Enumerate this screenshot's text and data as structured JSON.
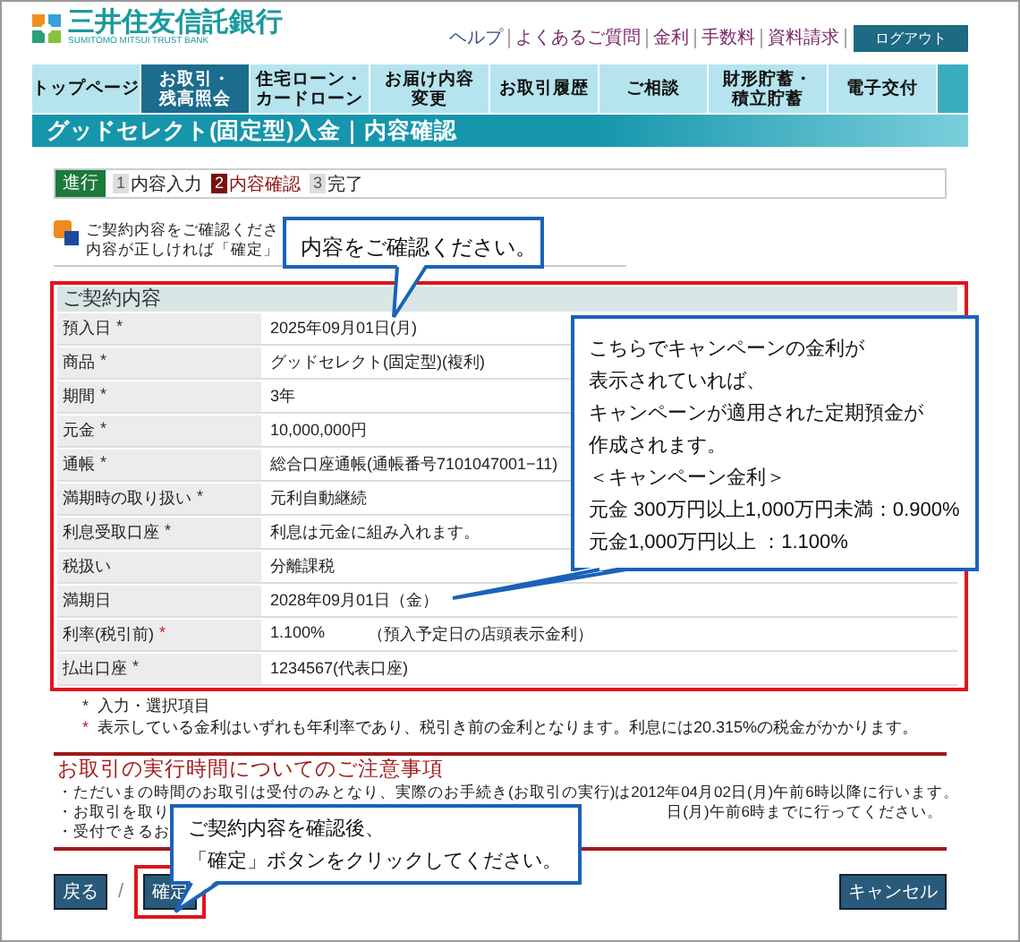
{
  "header": {
    "bank_name": "三井住友信託銀行",
    "bank_name_en": "SUMITOMO MITSUI TRUST BANK",
    "links": [
      "ヘルプ",
      "よくあるご質問",
      "金利",
      "手数料",
      "資料請求"
    ],
    "logout": "ログアウト"
  },
  "nav_tabs": [
    {
      "lines": [
        "トップページ"
      ],
      "selected": false
    },
    {
      "lines": [
        "お取引・",
        "残高照会"
      ],
      "selected": true
    },
    {
      "lines": [
        "住宅ローン・",
        "カードローン"
      ],
      "selected": false
    },
    {
      "lines": [
        "お届け内容",
        "変更"
      ],
      "selected": false
    },
    {
      "lines": [
        "お取引履歴"
      ],
      "selected": false
    },
    {
      "lines": [
        "ご相談"
      ],
      "selected": false
    },
    {
      "lines": [
        "財形貯蓄・",
        "積立貯蓄"
      ],
      "selected": false
    },
    {
      "lines": [
        "電子交付"
      ],
      "selected": false
    }
  ],
  "page_title": "グッドセレクト(固定型)入金｜内容確認",
  "progress": {
    "label": "進行",
    "steps": [
      {
        "number": "1",
        "label": "内容入力",
        "selected": false
      },
      {
        "number": "2",
        "label": "内容確認",
        "selected": true
      },
      {
        "number": "3",
        "label": "完了",
        "selected": false
      }
    ]
  },
  "instructions": [
    "ご契約内容をご確認くださ",
    "内容が正しければ「確定」"
  ],
  "contract": {
    "heading": "ご契約内容",
    "rows": [
      {
        "label": "預入日",
        "mark": {
          "text": "*",
          "color": "#333333"
        },
        "value": "2025年09月01日(月)"
      },
      {
        "label": "商品",
        "mark": {
          "text": "*",
          "color": "#333333"
        },
        "value": "グッドセレクト(固定型)(複利)"
      },
      {
        "label": "期間",
        "mark": {
          "text": "*",
          "color": "#333333"
        },
        "value": "3年"
      },
      {
        "label": "元金",
        "mark": {
          "text": "*",
          "color": "#333333"
        },
        "value": "10,000,000円"
      },
      {
        "label": "通帳",
        "mark": {
          "text": "*",
          "color": "#333333"
        },
        "value": "総合口座通帳(通帳番号7101047001−11)"
      },
      {
        "label": "満期時の取り扱い",
        "mark": {
          "text": "*",
          "color": "#333333"
        },
        "value": "元利自動継続"
      },
      {
        "label": "利息受取口座",
        "mark": {
          "text": "*",
          "color": "#333333"
        },
        "value": "利息は元金に組み入れます。"
      },
      {
        "label": "税扱い",
        "value": "分離課税"
      },
      {
        "label": "満期日",
        "value": "2028年09月01日（金）"
      },
      {
        "label": "利率(税引前)",
        "mark": {
          "text": "*",
          "color": "#c0202a"
        },
        "value": "1.100%",
        "note": "（預入予定日の店頭表示金利）"
      },
      {
        "label": "払出口座",
        "mark": {
          "text": "*",
          "color": "#333333"
        },
        "value": "1234567(代表口座)"
      }
    ]
  },
  "footnotes": [
    {
      "mark": "*",
      "kind": "input",
      "text": "入力・選択項目"
    },
    {
      "mark": "*",
      "kind": "tax",
      "text": "表示している金利はいずれも年利率であり、税引き前の金利となります。利息には20.315%の税金がかかります。"
    }
  ],
  "notice": {
    "title": "お取引の実行時間についてのご注意事項",
    "lines": [
      {
        "start": "・ただいまの時間のお取引は受付のみとなり、実際のお手続き(お取引の実行)は2012年04月02日(月)午前6時以降に行います。"
      },
      {
        "start": "・お取引を取り",
        "end": "日(月)午前6時までに行ってください。"
      },
      {
        "start": "・受付できるお"
      }
    ]
  },
  "buttons": {
    "back": "戻る",
    "separator": "/",
    "confirm": "確定",
    "cancel": "キャンセル"
  },
  "callouts": [
    {
      "lines": [
        "内容をご確認ください。"
      ]
    },
    {
      "lines": [
        "こちらでキャンペーンの金利が",
        "表示されていれば、",
        "キャンペーンが適用された定期預金が",
        "作成されます。",
        "＜キャンペーン金利＞",
        "元金 300万円以上1,000万円未満：0.900%",
        "元金1,000万円以上 ：1.100%"
      ]
    },
    {
      "lines": [
        "ご契約内容を確認後、",
        "「確定」ボタンをクリックしてください。"
      ]
    }
  ]
}
